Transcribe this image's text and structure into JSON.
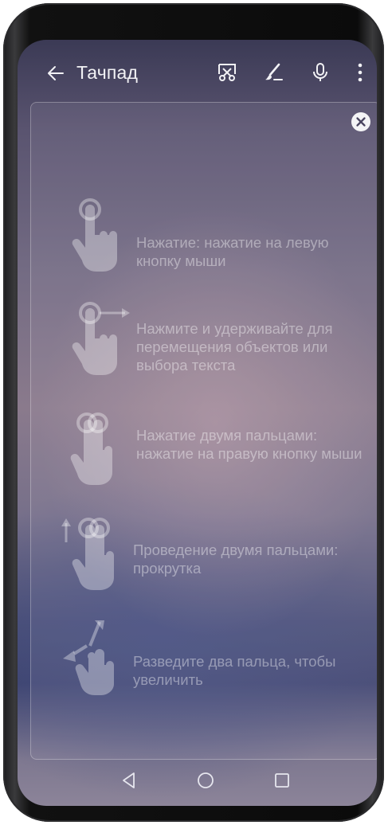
{
  "header": {
    "title": "Тачпад",
    "icons": [
      "back-arrow-icon",
      "screenshot-scissors-icon",
      "pen-icon",
      "microphone-icon",
      "more-vert-icon"
    ]
  },
  "overlay": {
    "close_icon": "close-icon",
    "gestures": [
      {
        "icon": "tap-icon",
        "text": "Нажатие: нажатие на левую кнопку мыши"
      },
      {
        "icon": "press-drag-icon",
        "text": "Нажмите и удерживайте для перемещения объектов или выбора текста"
      },
      {
        "icon": "two-finger-tap-icon",
        "text": "Нажатие двумя пальцами: нажатие на правую кнопку мыши"
      },
      {
        "icon": "two-finger-scroll-icon",
        "text": "Проведение двумя пальцами: прокрутка"
      },
      {
        "icon": "pinch-zoom-icon",
        "text": "Разведите два пальца, чтобы увеличить"
      }
    ]
  },
  "navbar": {
    "icons": [
      "nav-back-icon",
      "nav-home-icon",
      "nav-recents-icon"
    ]
  },
  "colors": {
    "text": "#f2f2f5",
    "hint_text": "rgba(255,255,255,0.40)",
    "hand": "rgba(255,255,255,0.35)"
  }
}
